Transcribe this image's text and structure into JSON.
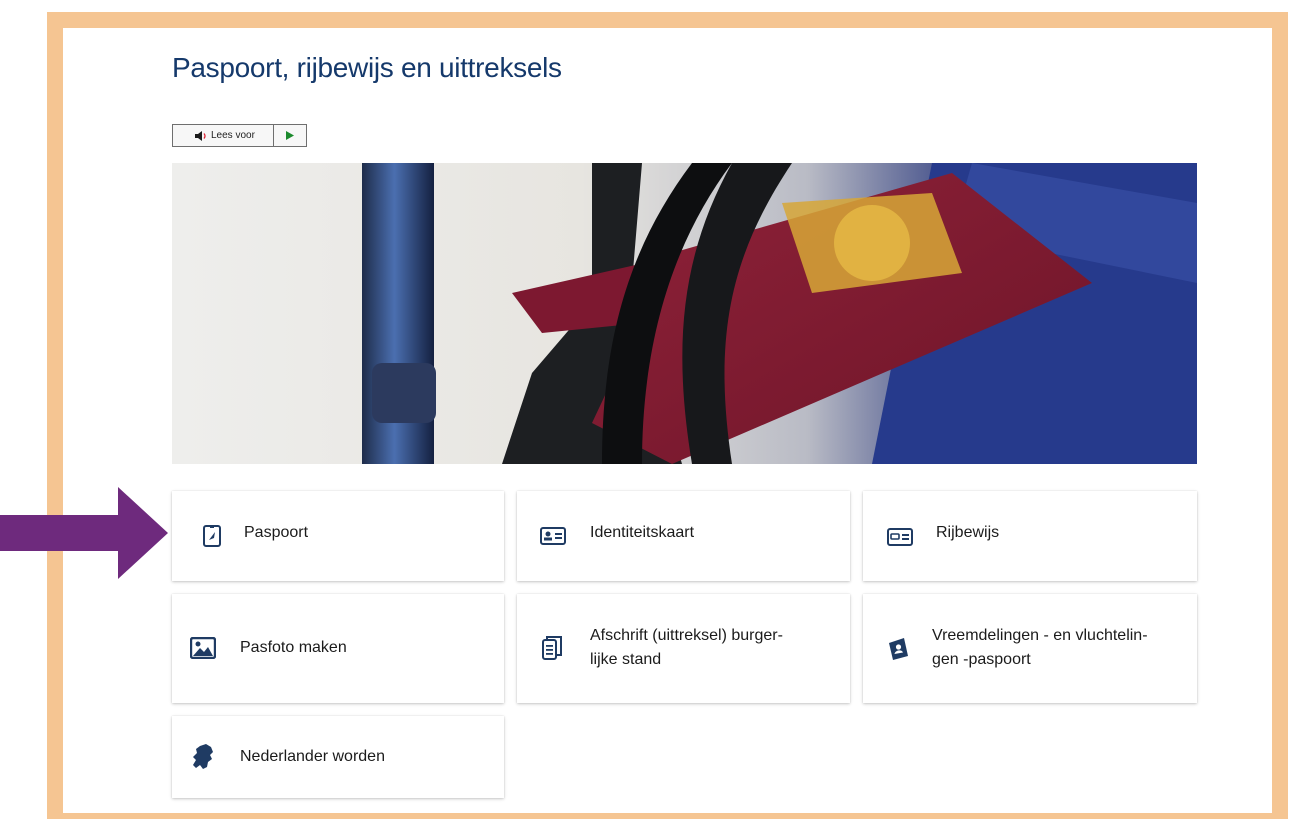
{
  "page": {
    "title": "Paspoort, rijbewijs en uittreksels",
    "readspeaker_label": "Lees voor"
  },
  "tiles": [
    {
      "label": "Paspoort",
      "icon": "passport-icon"
    },
    {
      "label": "Identiteitskaart",
      "icon": "id-card-icon"
    },
    {
      "label": "Rijbewijs",
      "icon": "driving-license-icon"
    },
    {
      "label_line1": "Pasfoto maken",
      "icon": "photo-icon"
    },
    {
      "label_line1": "Afschrift (uittreksel) burger-",
      "label_line2": "lijke stand",
      "icon": "document-icon"
    },
    {
      "label_line1": "Vreemdelingen - en vluchtelin-",
      "label_line2": "gen -paspoort",
      "icon": "travel-document-icon"
    },
    {
      "label": "Nederlander worden",
      "icon": "netherlands-map-icon"
    }
  ],
  "colors": {
    "frame": "#f5c592",
    "title": "#15396b",
    "icon": "#1f3b63",
    "arrow": "#6e2a7d"
  }
}
